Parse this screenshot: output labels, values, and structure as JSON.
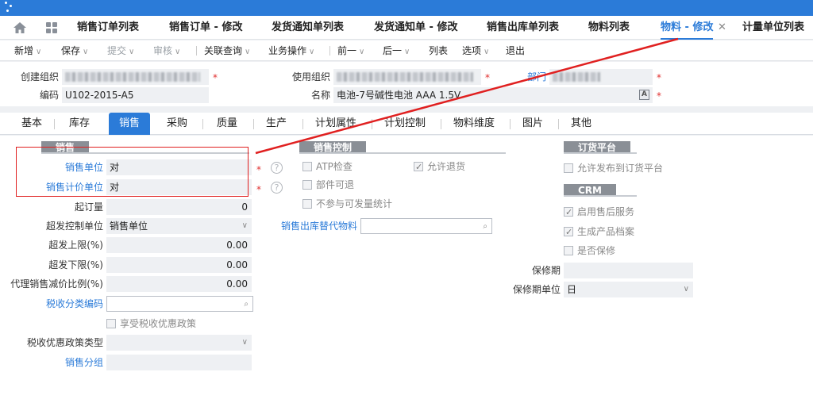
{
  "tabs": [
    {
      "label": "销售订单列表"
    },
    {
      "label": "销售订单 - 修改"
    },
    {
      "label": "发货通知单列表"
    },
    {
      "label": "发货通知单 - 修改"
    },
    {
      "label": "销售出库单列表"
    },
    {
      "label": "物料列表"
    },
    {
      "label": "物料 - 修改",
      "active": true
    },
    {
      "label": "计量单位列表"
    }
  ],
  "tab_close": "✕",
  "toolbar": {
    "new": "新增",
    "save": "保存",
    "submit": "提交",
    "audit": "审核",
    "related": "关联查询",
    "business": "业务操作",
    "prev": "前一",
    "next": "后一",
    "list": "列表",
    "options": "选项",
    "exit": "退出"
  },
  "header": {
    "create_org_label": "创建组织",
    "use_org_label": "使用组织",
    "dept_label": "部门",
    "code_label": "编码",
    "code_value": "U102-2015-A5",
    "name_label": "名称",
    "name_value": "电池-7号碱性电池 AAA 1.5V",
    "lang_badge": "A"
  },
  "form_tabs": [
    "基本",
    "库存",
    "销售",
    "采购",
    "质量",
    "生产",
    "计划属性",
    "计划控制",
    "物料维度",
    "图片",
    "其他"
  ],
  "sales": {
    "group_title": "销售",
    "sale_unit_label": "销售单位",
    "sale_unit_value": "对",
    "price_unit_label": "销售计价单位",
    "price_unit_value": "对",
    "min_order_label": "起订量",
    "min_order_value": "0",
    "over_ctrl_label": "超发控制单位",
    "over_ctrl_value": "销售单位",
    "over_upper_label": "超发上限(%)",
    "over_upper_value": "0.00",
    "over_lower_label": "超发下限(%)",
    "over_lower_value": "0.00",
    "agent_ratio_label": "代理销售减价比例(%)",
    "agent_ratio_value": "0.00",
    "tax_code_label": "税收分类编码",
    "tax_pref_chk": "享受税收优惠政策",
    "tax_policy_label": "税收优惠政策类型",
    "sale_group_label": "销售分组",
    "help": "?"
  },
  "sales_ctrl": {
    "group_title": "销售控制",
    "atp": "ATP检查",
    "allow_return": "允许退货",
    "part_return": "部件可退",
    "no_stat": "不参与可发量统计",
    "substitute_label": "销售出库替代物料"
  },
  "order_platform": {
    "group_title": "订货平台",
    "allow_publish": "允许发布到订货平台"
  },
  "crm": {
    "group_title": "CRM",
    "after_sale": "启用售后服务",
    "gen_archive": "生成产品档案",
    "warranty": "是否保修",
    "warranty_period_label": "保修期",
    "warranty_unit_label": "保修期单位",
    "warranty_unit_value": "日"
  }
}
